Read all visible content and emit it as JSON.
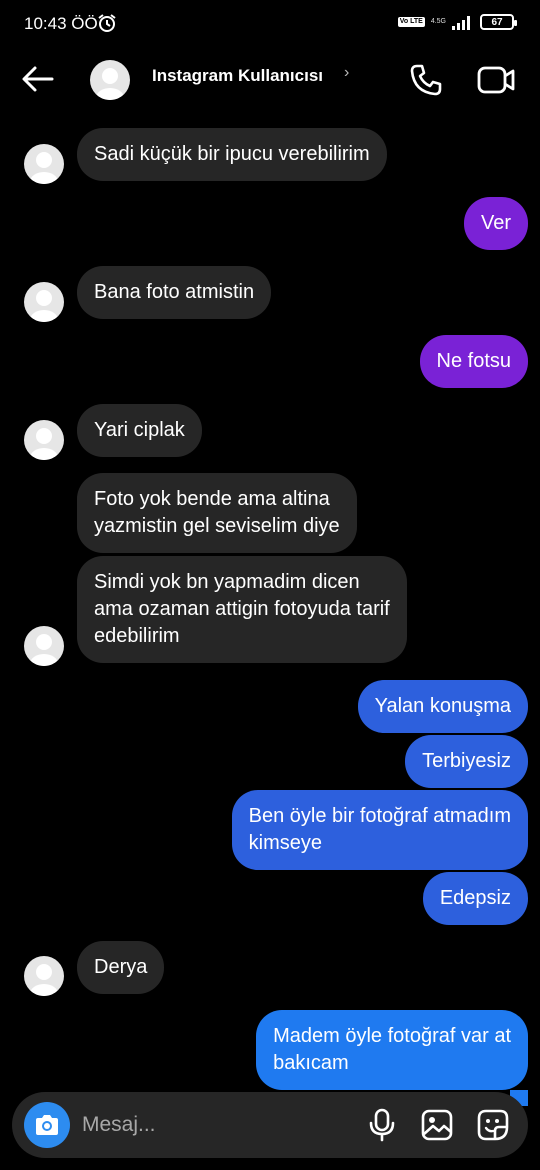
{
  "status_bar": {
    "time": "10:43 ÖÖ",
    "volte_label": "Vo LTE",
    "network_label": "4.5G",
    "battery": "67"
  },
  "header": {
    "title": "Instagram Kullanıcısı",
    "chevron": "›"
  },
  "colors": {
    "incoming": "#262626",
    "outgoing_purple": "#7a22d6",
    "outgoing_blue": "#2d60dd",
    "outgoing_blue_light": "#1f7af0"
  },
  "messages": [
    {
      "dir": "in",
      "text": "Sadi küçük bir ipucu verebilirim"
    },
    {
      "dir": "out",
      "text": "Ver"
    },
    {
      "dir": "in",
      "text": "Bana foto atmistin"
    },
    {
      "dir": "out",
      "text": "Ne fotsu"
    },
    {
      "dir": "in",
      "text": "Yari ciplak"
    },
    {
      "dir": "in",
      "text": "Foto yok bende ama altina\nyazmistin gel seviselim diye"
    },
    {
      "dir": "in",
      "text": "Simdi yok bn yapmadim dicen\nama ozaman attigin fotoyuda tarif\nedebilirim"
    },
    {
      "dir": "out",
      "text": "Yalan konuşma"
    },
    {
      "dir": "out",
      "text": "Terbiyesiz"
    },
    {
      "dir": "out",
      "text": "Ben öyle bir fotoğraf atmadım\nkimseye"
    },
    {
      "dir": "out",
      "text": "Edepsiz"
    },
    {
      "dir": "in",
      "text": "Derya"
    },
    {
      "dir": "out",
      "text": "Madem öyle fotoğraf var at\nbakıcam"
    }
  ],
  "composer": {
    "placeholder": "Mesaj..."
  },
  "icons": {
    "back": "back-arrow-icon",
    "call": "phone-icon",
    "video": "video-camera-icon",
    "camera": "camera-icon",
    "mic": "microphone-icon",
    "gallery": "gallery-icon",
    "sticker": "sticker-icon"
  }
}
